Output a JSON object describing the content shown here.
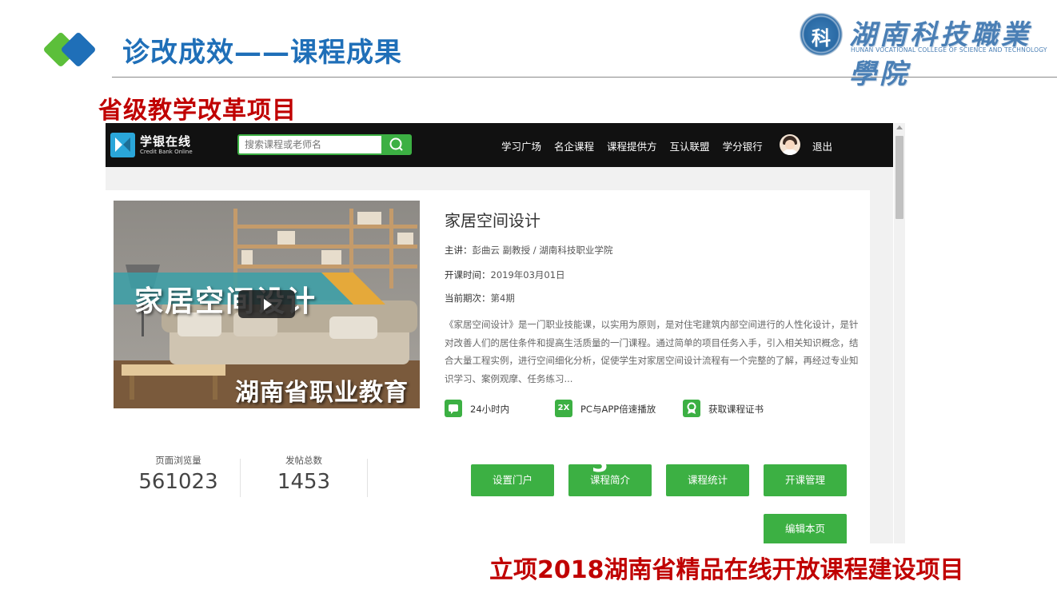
{
  "slide": {
    "title": "诊改成效——课程成果",
    "subtitle": "省级教学改革项目",
    "footer": "立项2018湖南省精品在线开放课程建设项目"
  },
  "college": {
    "name_cn": "湖南科技職業學院",
    "name_en": "HUNAN VOCATIONAL COLLEGE OF SCIENCE AND TECHNOLOGY",
    "seal_glyph": "科"
  },
  "site": {
    "brand": {
      "name": "学银在线",
      "sub": "Credit Bank Online"
    },
    "search": {
      "placeholder": "搜索课程或老师名"
    },
    "nav": [
      "学习广场",
      "名企课程",
      "课程提供方",
      "互认联盟",
      "学分银行"
    ],
    "logout": "退出",
    "course": {
      "cover_text": "家居空间设计",
      "cover_text2": "湖南省职业教育",
      "title": "家居空间设计",
      "lecturer_label": "主讲：",
      "lecturer": "彭曲云 副教授 / 湖南科技职业学院",
      "start_label": "开课时间：",
      "start": "2019年03月01日",
      "term_label": "当前期次：",
      "term": "第4期",
      "description": "《家居空间设计》是一门职业技能课，以实用为原则，是对住宅建筑内部空间进行的人性化设计，是针对改善人们的居住条件和提高生活质量的一门课程。通过简单的项目任务入手，引入相关知识概念，结合大量工程实例，进行空间细化分析，促使学生对家居空间设计流程有一个完整的了解，再经过专业知识学习、案例观摩、任务练习...",
      "features": [
        {
          "icon": "chat-icon",
          "icon_text": "",
          "text": "24小时内"
        },
        {
          "icon": "speed-icon",
          "icon_text": "2X",
          "text": "PC与APP倍速播放"
        },
        {
          "icon": "certificate-icon",
          "icon_text": "",
          "text": "获取课程证书"
        }
      ]
    },
    "stats": [
      {
        "label": "页面浏览量",
        "value": "561023"
      },
      {
        "label": "发帖总数",
        "value": "1453"
      }
    ],
    "actions": [
      "设置门户",
      "课程简介",
      "课程统计",
      "开课管理",
      "编辑本页"
    ],
    "overlay_mark": "3"
  }
}
